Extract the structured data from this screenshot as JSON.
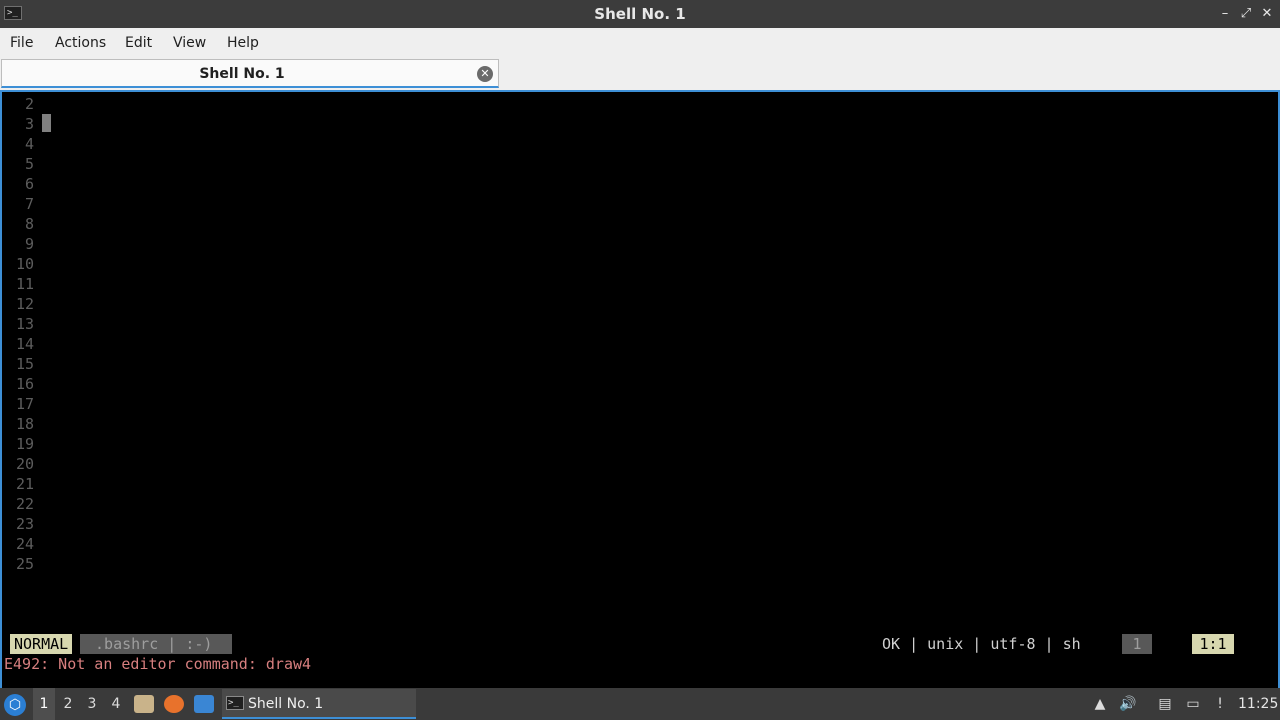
{
  "window": {
    "title": "Shell No. 1",
    "controls": {
      "minimize": "–",
      "maximize": "⤢",
      "close": "✕"
    }
  },
  "menu": [
    "File",
    "Actions",
    "Edit",
    "View",
    "Help"
  ],
  "tab": {
    "label": "Shell No. 1",
    "close_glyph": "✕"
  },
  "editor": {
    "line_numbers": [
      "2",
      "3",
      "4",
      "5",
      "6",
      "7",
      "8",
      "9",
      "10",
      "11",
      "12",
      "13",
      "14",
      "15",
      "16",
      "17",
      "18",
      "19",
      "20",
      "21",
      "22",
      "23",
      "24",
      "25"
    ],
    "status": {
      "mode": "NORMAL",
      "filename": " .bashrc | :-)",
      "info": "OK | unix | utf-8 | sh",
      "percent": "1",
      "position": "1:1"
    },
    "message": "E492: Not an editor command: draw4"
  },
  "taskbar": {
    "workspaces": [
      "1",
      "2",
      "3",
      "4"
    ],
    "active_workspace": "1",
    "launchers": [
      "file-manager-icon",
      "firefox-icon",
      "desktop-icon"
    ],
    "task": {
      "label": "Shell No. 1"
    },
    "tray": [
      "network-icon",
      "volume-icon",
      "clipboard-icon",
      "display-icon",
      "update-icon"
    ],
    "clock": "11:25"
  },
  "colors": {
    "accent": "#3d8fd6",
    "statusline_mode_bg": "#d7d7af",
    "error_text": "#d77f7f"
  }
}
